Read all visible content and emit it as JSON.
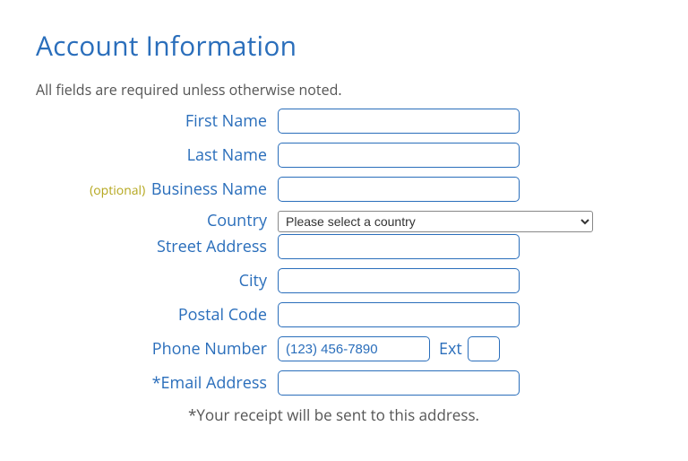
{
  "heading": "Account Information",
  "requiredNote": "All fields are required unless otherwise noted.",
  "labels": {
    "firstName": "First Name",
    "lastName": "Last Name",
    "businessName": "Business Name",
    "optionalTag": "(optional)",
    "country": "Country",
    "streetAddress": "Street Address",
    "city": "City",
    "postalCode": "Postal Code",
    "phoneNumber": "Phone Number",
    "ext": "Ext",
    "emailAddress": "*Email Address"
  },
  "placeholders": {
    "phone": "(123) 456-7890"
  },
  "countrySelected": "Please select a country",
  "footnote": "*Your receipt will be sent to this address."
}
